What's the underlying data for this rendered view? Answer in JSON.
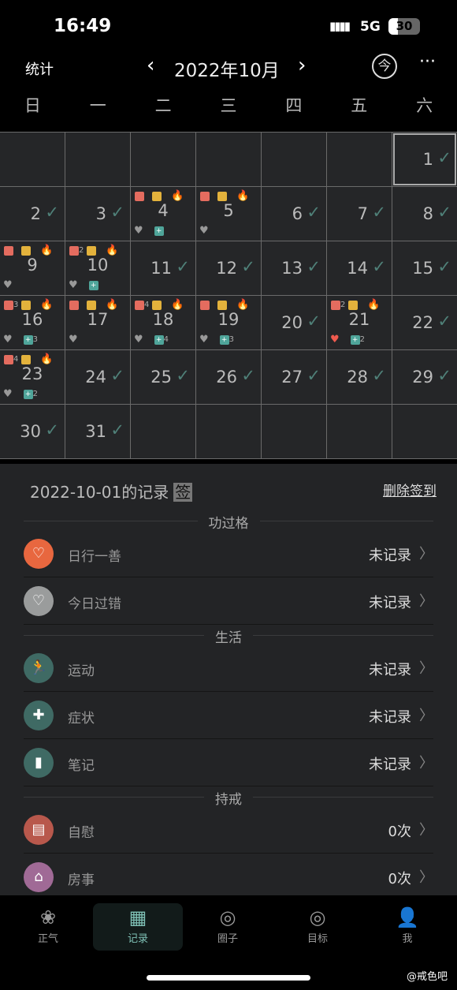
{
  "status": {
    "time": "16:49",
    "network": "5G",
    "battery": "30"
  },
  "header": {
    "stats": "统计",
    "month": "2022年10月",
    "today": "今",
    "more": "···"
  },
  "weekdays": [
    "日",
    "一",
    "二",
    "三",
    "四",
    "五",
    "六"
  ],
  "calendar": {
    "leading_blank": 6,
    "selected": 1,
    "days": [
      {
        "d": 1,
        "check": true
      },
      {
        "d": 2,
        "check": true
      },
      {
        "d": 3,
        "check": true
      },
      {
        "d": 4,
        "roll": "",
        "mon": true,
        "fire": true,
        "low": "broken",
        "kit": ""
      },
      {
        "d": 5,
        "roll": "",
        "mon": true,
        "fire": true,
        "low": "broken"
      },
      {
        "d": 6,
        "check": true
      },
      {
        "d": 7,
        "check": true
      },
      {
        "d": 8,
        "check": true
      },
      {
        "d": 9,
        "roll": "",
        "mon": true,
        "fire": true,
        "low": "broken"
      },
      {
        "d": 10,
        "roll": "2",
        "mon": true,
        "fire": true,
        "low": "broken",
        "kit": ""
      },
      {
        "d": 11,
        "check": true
      },
      {
        "d": 12,
        "check": true
      },
      {
        "d": 13,
        "check": true
      },
      {
        "d": 14,
        "check": true
      },
      {
        "d": 15,
        "check": true
      },
      {
        "d": 16,
        "roll": "3",
        "mon": true,
        "fire": true,
        "low": "broken",
        "kit": "3"
      },
      {
        "d": 17,
        "roll": "",
        "mon": true,
        "fire": true,
        "low": "broken"
      },
      {
        "d": 18,
        "roll": "4",
        "mon": true,
        "fire": true,
        "low": "broken",
        "kit": "4"
      },
      {
        "d": 19,
        "roll": "",
        "mon": true,
        "fire": true,
        "low": "broken",
        "kit": "3"
      },
      {
        "d": 20,
        "check": true
      },
      {
        "d": 21,
        "roll": "2",
        "mon": true,
        "fire": true,
        "low": "heart",
        "kit": "2"
      },
      {
        "d": 22,
        "check": true
      },
      {
        "d": 23,
        "roll": "4",
        "mon": true,
        "fire": true,
        "low": "broken",
        "kit": "2"
      },
      {
        "d": 24,
        "check": true
      },
      {
        "d": 25,
        "check": true
      },
      {
        "d": 26,
        "check": true
      },
      {
        "d": 27,
        "check": true
      },
      {
        "d": 28,
        "check": true
      },
      {
        "d": 29,
        "check": true
      },
      {
        "d": 30,
        "check": true
      },
      {
        "d": 31,
        "check": true
      }
    ]
  },
  "record": {
    "title": "2022-10-01的记录",
    "sign": "签",
    "delete": "删除签到",
    "sections": [
      {
        "title": "功过格",
        "items": [
          {
            "label": "日行一善",
            "value": "未记录",
            "icon": "heart-icon",
            "color": "#e8673f"
          },
          {
            "label": "今日过错",
            "value": "未记录",
            "icon": "broken-heart-icon",
            "color": "#9a9c9c"
          }
        ]
      },
      {
        "title": "生活",
        "items": [
          {
            "label": "运动",
            "value": "未记录",
            "icon": "running-icon",
            "color": "#3f6a64"
          },
          {
            "label": "症状",
            "value": "未记录",
            "icon": "medkit-icon",
            "color": "#3f6a64"
          },
          {
            "label": "笔记",
            "value": "未记录",
            "icon": "notebook-icon",
            "color": "#3f6a64"
          }
        ]
      },
      {
        "title": "持戒",
        "items": [
          {
            "label": "自慰",
            "value": "0次",
            "icon": "tissue-roll-icon",
            "color": "#b8584c"
          },
          {
            "label": "房事",
            "value": "0次",
            "icon": "house-icon",
            "color": "#a06a96"
          }
        ]
      }
    ]
  },
  "nav": [
    {
      "label": "正气",
      "icon": "lotus-icon"
    },
    {
      "label": "记录",
      "icon": "calendar-icon",
      "active": true
    },
    {
      "label": "圈子",
      "icon": "circle-icon"
    },
    {
      "label": "目标",
      "icon": "target-icon"
    },
    {
      "label": "我",
      "icon": "user-icon"
    }
  ],
  "watermark": "@戒色吧"
}
